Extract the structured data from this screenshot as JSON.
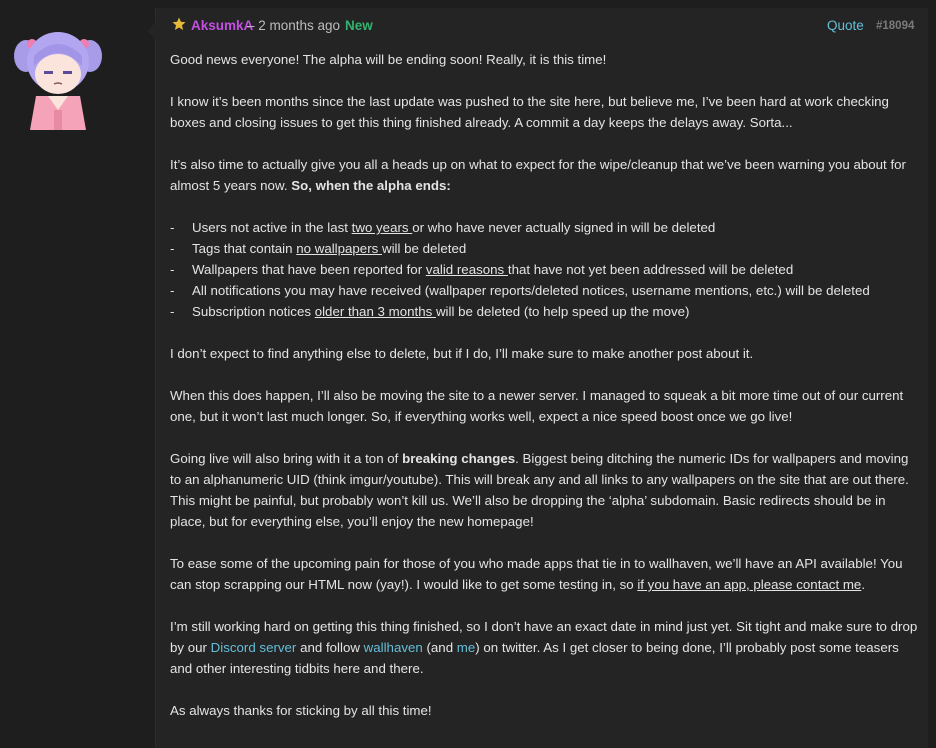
{
  "post": {
    "author": "AksumkA",
    "time": "– 2 months ago",
    "new_badge": "New",
    "quote_label": "Quote",
    "post_id": "#18094",
    "p1": "Good news everyone! The alpha will be ending soon! Really, it is this time!",
    "p2": "I know it’s been months since the last update was pushed to the site here, but believe me, I’ve been hard at work checking boxes and closing issues to get this thing finished already. A commit a day keeps the delays away. Sorta...",
    "p3a": "It’s also time to actually give you all a heads up on what to expect for the wipe/cleanup that we’ve been warning you about for almost 5 years now. ",
    "p3b": "So, when the alpha ends:",
    "list": [
      {
        "a": "Users not active in the last ",
        "u": "two years ",
        "b": "or who have never actually signed in will be deleted"
      },
      {
        "a": "Tags that contain ",
        "u": "no wallpapers ",
        "b": "will be deleted"
      },
      {
        "a": "Wallpapers that have been reported for ",
        "u": "valid reasons ",
        "b": "that have not yet been addressed will be deleted"
      },
      {
        "a": "All notifications you may have received (wallpaper reports/deleted notices, username mentions, etc.) will be deleted",
        "u": "",
        "b": ""
      },
      {
        "a": "Subscription notices ",
        "u": "older than 3 months ",
        "b": "will be deleted (to help speed up the move)"
      }
    ],
    "dash": "-",
    "p4": "I don’t expect to find anything else to delete, but if I do, I’ll make sure to make another post about it.",
    "p5": "When this does happen, I’ll also be moving the site to a newer server. I managed to squeak a bit more time out of our current one, but it won’t last much longer. So, if everything works well, expect a nice speed boost once we go live!",
    "p6a": "Going live will also bring with it a ton of ",
    "p6b": "breaking changes",
    "p6c": ". Biggest being ditching the numeric IDs for wallpapers and moving to an alphanumeric UID (think imgur/youtube). This will break any and all links to any wallpapers on the site that are out there. This might be painful, but probably won’t kill us. We’ll also be dropping the ‘alpha’ subdomain. Basic redirects should be in place, but for everything else, you’ll enjoy the new homepage!",
    "p7a": "To ease some of the upcoming pain for those of you who made apps that tie in to wallhaven, we’ll have an API available! You can stop scrapping our HTML now (yay!). I would like to get some testing in, so ",
    "p7b": "if you have an app, please contact me",
    "p7c": ".",
    "p8a": "I’m still working hard on getting this thing finished, so I don’t have an exact date in mind just yet. Sit tight and make sure to drop by our ",
    "p8b": "Discord server",
    "p8c": " and follow ",
    "p8d": "wallhaven",
    "p8e": " (and ",
    "p8f": "me",
    "p8g": ") on twitter. As I get closer to being done, I’ll probably post some teasers and other interesting tidbits here and there.",
    "p9": "As always thanks for sticking by all this time!"
  },
  "colors": {
    "author": "#c34fe3",
    "new": "#33b36d",
    "link": "#63bfd9",
    "star": "#e6b93a"
  }
}
